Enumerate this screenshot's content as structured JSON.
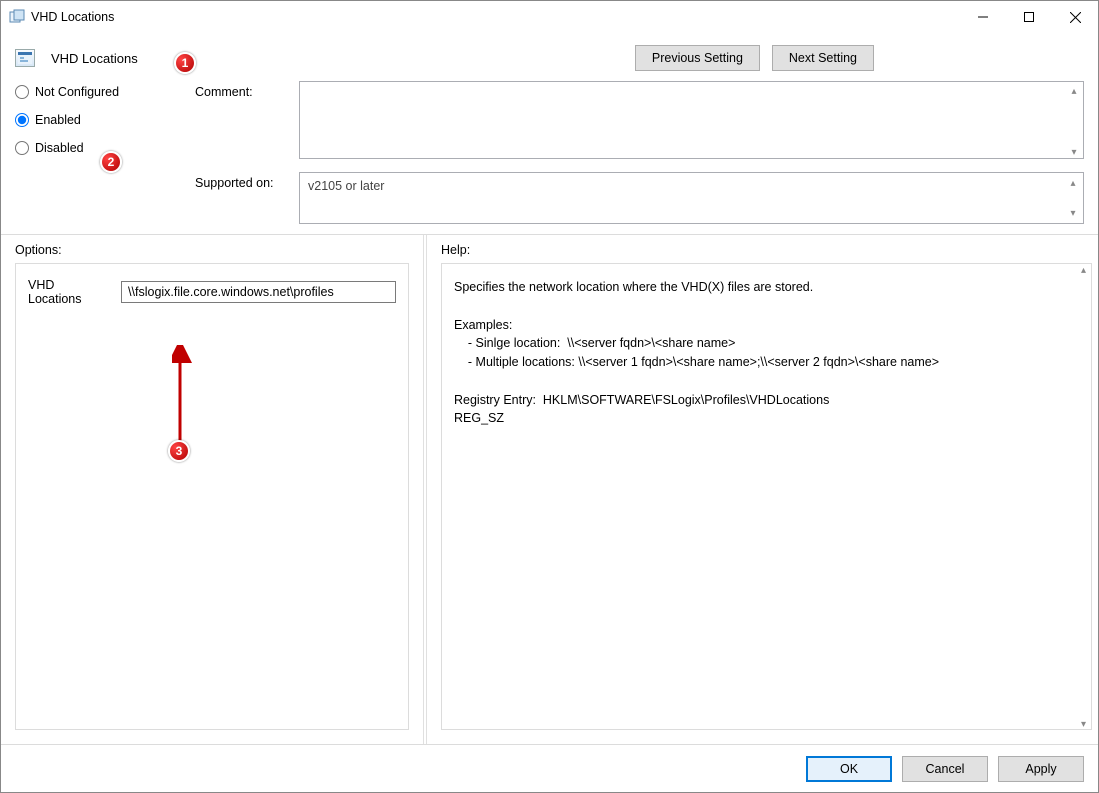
{
  "window": {
    "title": "VHD Locations"
  },
  "setting": {
    "icon_label": "policy-icon",
    "title": "VHD Locations",
    "nav_prev": "Previous Setting",
    "nav_next": "Next Setting"
  },
  "state": {
    "not_configured_label": "Not Configured",
    "enabled_label": "Enabled",
    "disabled_label": "Disabled",
    "selected": "enabled"
  },
  "fields": {
    "comment_label": "Comment:",
    "comment_value": "",
    "supported_label": "Supported on:",
    "supported_value": "v2105 or later"
  },
  "options": {
    "panel_title": "Options:",
    "item_label": "VHD Locations",
    "item_value": "\\\\fslogix.file.core.windows.net\\profiles"
  },
  "help": {
    "panel_title": "Help:",
    "text": "Specifies the network location where the VHD(X) files are stored.\n\nExamples:\n    - Sinlge location:  \\\\<server fqdn>\\<share name>\n    - Multiple locations: \\\\<server 1 fqdn>\\<share name>;\\\\<server 2 fqdn>\\<share name>\n\nRegistry Entry:  HKLM\\SOFTWARE\\FSLogix\\Profiles\\VHDLocations\nREG_SZ"
  },
  "buttons": {
    "ok": "OK",
    "cancel": "Cancel",
    "apply": "Apply"
  },
  "annotations": {
    "m1": "1",
    "m2": "2",
    "m3": "3"
  }
}
